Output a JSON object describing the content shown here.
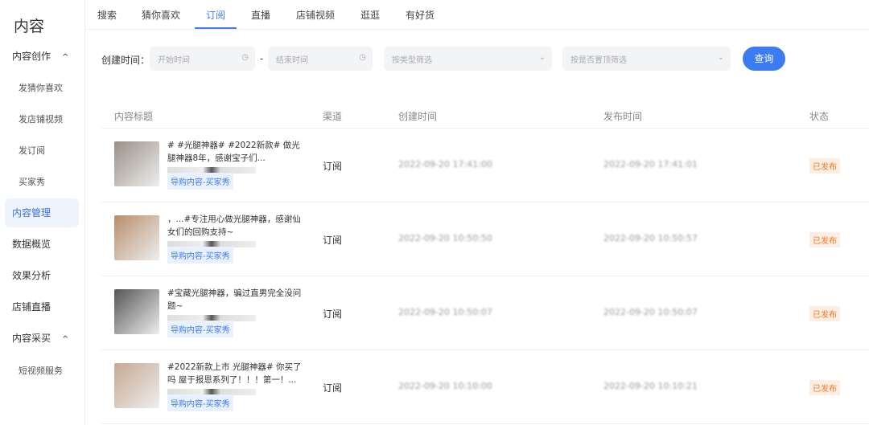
{
  "sidebar": {
    "brand": "内容",
    "items": [
      {
        "label": "内容创作",
        "caret": "^"
      },
      {
        "label": "发猜你喜欢"
      },
      {
        "label": "发店铺视频"
      },
      {
        "label": "发订阅"
      },
      {
        "label": "买家秀"
      },
      {
        "label": "内容管理"
      },
      {
        "label": "数据概览"
      },
      {
        "label": "效果分析"
      },
      {
        "label": "店铺直播"
      },
      {
        "label": "内容采买",
        "caret": "^"
      },
      {
        "label": "短视频服务"
      }
    ]
  },
  "tabs": [
    "搜索",
    "猜你喜欢",
    "订阅",
    "直播",
    "店铺视频",
    "逛逛",
    "有好货"
  ],
  "filters": {
    "label": "创建时间：",
    "start": "开始时间",
    "end": "结束时间",
    "dash": "-",
    "type": "按类型筛选",
    "top": "按是否置顶筛选",
    "query": "查询"
  },
  "table": {
    "headers": [
      "内容标题",
      "渠道",
      "创建时间",
      "发布时间",
      "状态"
    ],
    "rows": [
      {
        "title": "# #光腿神器# #2022新款# 做光腿神器8年，感谢宝子们...",
        "tag": "导购内容-买家秀",
        "channel": "订阅",
        "created": "2022-09-20 17:41:00",
        "published": "2022-09-20 17:41:01",
        "status": "已发布",
        "color": "#9a8f86"
      },
      {
        "title": "，...#专注用心做光腿神器，感谢仙女们的回购支持~",
        "tag": "导购内容-买家秀",
        "channel": "订阅",
        "created": "2022-09-20 10:50:50",
        "published": "2022-09-20 10:50:57",
        "status": "已发布",
        "color": "#b98d6a"
      },
      {
        "title": "#宝藏光腿神器，骗过直男完全没问题~",
        "tag": "导购内容-买家秀",
        "channel": "订阅",
        "created": "2022-09-20 10:50:07",
        "published": "2022-09-20 10:50:07",
        "status": "已发布",
        "color": "#555"
      },
      {
        "title": "#2022新款上市 光腿神器# 你买了吗 屋于报恩系列了！！！第一！...",
        "tag": "导购内容-买家秀",
        "channel": "订阅",
        "created": "2022-09-20 10:10:00",
        "published": "2022-09-20 10:10:21",
        "status": "已发布",
        "color": "#c7a890"
      }
    ]
  }
}
